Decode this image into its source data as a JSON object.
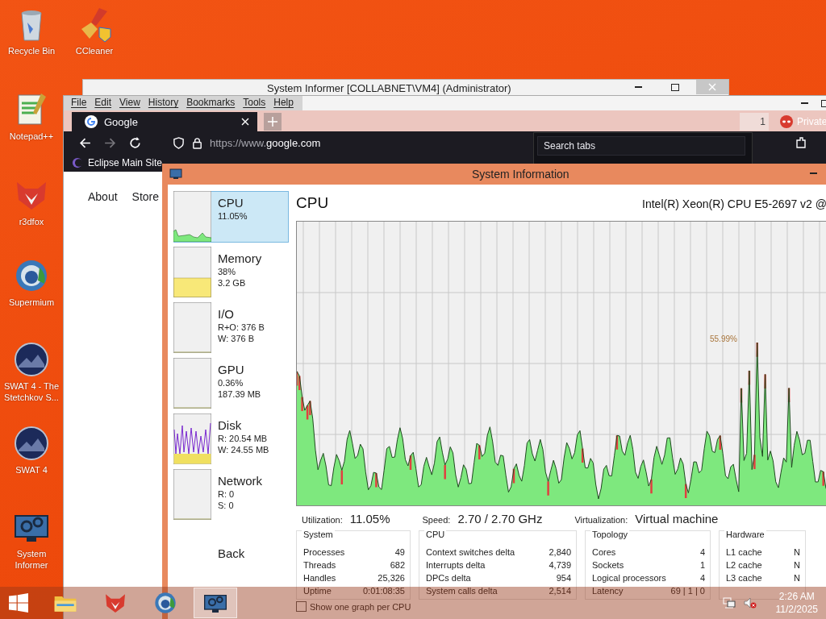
{
  "desktop_icons": [
    {
      "label": "Recycle Bin",
      "kind": "bin"
    },
    {
      "label": "CCleaner",
      "kind": "broom"
    },
    {
      "label": "Notepad++",
      "kind": "notepad"
    },
    {
      "label": "r3dfox",
      "kind": "fox"
    },
    {
      "label": "Supermium",
      "kind": "globe"
    },
    {
      "label": "SWAT 4 - The Stetchkov S...",
      "kind": "game"
    },
    {
      "label": "SWAT 4",
      "kind": "game"
    },
    {
      "label": "System Informer",
      "kind": "gears"
    }
  ],
  "back_window": {
    "title": "System Informer [COLLABNET\\VM4] (Administrator)"
  },
  "browser": {
    "menu": [
      "File",
      "Edit",
      "View",
      "History",
      "Bookmarks",
      "Tools",
      "Help"
    ],
    "tabs": [
      {
        "title": "Google",
        "selected": true
      }
    ],
    "tab_count": "1",
    "private_label": "Private",
    "url_scheme": "https://www.",
    "url_host": "google.com",
    "search_tabs": {
      "placeholder": "Search tabs"
    },
    "bookmarks": [
      "Eclipse Main Site"
    ],
    "page_links": [
      "About",
      "Store"
    ]
  },
  "system_information": {
    "title": "System Information",
    "items": [
      {
        "name": "CPU",
        "lines": [
          "11.05%"
        ],
        "selected": true,
        "kind": "cpu"
      },
      {
        "name": "Memory",
        "lines": [
          "38%",
          "3.2 GB"
        ],
        "selected": false,
        "kind": "memory"
      },
      {
        "name": "I/O",
        "lines": [
          "R+O: 376 B",
          "W: 376 B"
        ],
        "selected": false,
        "kind": "flat"
      },
      {
        "name": "GPU",
        "lines": [
          "0.36%",
          "187.39 MB"
        ],
        "selected": false,
        "kind": "flat"
      },
      {
        "name": "Disk",
        "lines": [
          "R: 20.54 MB",
          "W: 24.55 MB"
        ],
        "selected": false,
        "kind": "disk"
      },
      {
        "name": "Network",
        "lines": [
          "R: 0",
          "S: 0"
        ],
        "selected": false,
        "kind": "flat"
      }
    ],
    "back_button": "Back",
    "heading": "CPU",
    "cpu_model": "Intel(R) Xeon(R) CPU E5-2697 v2 @",
    "peak_label": "55.99%",
    "stats": [
      {
        "label": "Utilization:",
        "value": "11.05%"
      },
      {
        "label": "Speed:",
        "value": "2.70 / 2.70 GHz"
      },
      {
        "label": "Virtualization:",
        "value": "Virtual machine"
      }
    ],
    "groups": [
      {
        "title": "System",
        "rows": [
          {
            "label": "Processes",
            "value": "49"
          },
          {
            "label": "Threads",
            "value": "682"
          },
          {
            "label": "Handles",
            "value": "25,326"
          },
          {
            "label": "Uptime",
            "value": "0:01:08:35"
          }
        ]
      },
      {
        "title": "CPU",
        "rows": [
          {
            "label": "Context switches delta",
            "value": "2,840"
          },
          {
            "label": "Interrupts delta",
            "value": "4,739"
          },
          {
            "label": "DPCs delta",
            "value": "954"
          },
          {
            "label": "System calls delta",
            "value": "2,514"
          }
        ]
      },
      {
        "title": "Topology",
        "rows": [
          {
            "label": "Cores",
            "value": "4"
          },
          {
            "label": "Sockets",
            "value": "1"
          },
          {
            "label": "Logical processors",
            "value": "4"
          },
          {
            "label": "Latency",
            "value": "69 | 1 | 0"
          }
        ]
      },
      {
        "title": "Hardware",
        "rows": [
          {
            "label": "L1 cache",
            "value": "N"
          },
          {
            "label": "L2 cache",
            "value": "N"
          },
          {
            "label": "L3 cache",
            "value": "N"
          }
        ]
      }
    ],
    "per_cpu_checkbox": {
      "label": "Show one graph per CPU",
      "checked": false
    }
  },
  "taskbar": {
    "apps": [
      {
        "kind": "explorer",
        "selected": false
      },
      {
        "kind": "fox",
        "selected": false
      },
      {
        "kind": "globe",
        "selected": false
      },
      {
        "kind": "gears",
        "selected": true
      }
    ],
    "time": "2:26 AM",
    "date": "11/2/2025"
  }
}
